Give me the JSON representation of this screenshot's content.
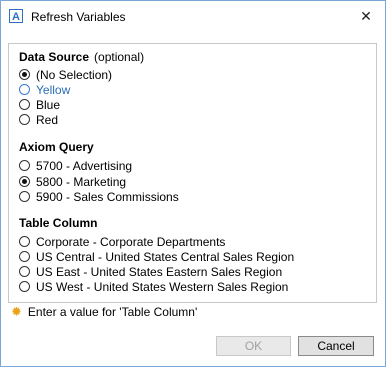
{
  "window": {
    "title": "Refresh Variables",
    "app_icon_letter": "A",
    "close_glyph": "✕"
  },
  "data_source": {
    "heading": "Data Source",
    "optional": "(optional)",
    "options": [
      "(No Selection)",
      "Yellow",
      "Blue",
      "Red"
    ],
    "selected_index": 0
  },
  "axiom_query": {
    "heading": "Axiom Query",
    "options": [
      "5700 - Advertising",
      "5800 - Marketing",
      "5900 - Sales Commissions"
    ],
    "selected_index": 1
  },
  "table_column": {
    "heading": "Table Column",
    "options": [
      "Corporate - Corporate Departments",
      "US Central - United States Central Sales Region",
      "US East - United States Eastern Sales Region",
      "US West - United States Western Sales Region"
    ],
    "selected_index": null
  },
  "status": {
    "message": "Enter a value for 'Table Column'",
    "icon": "sun-icon",
    "icon_color": "#e8a21a"
  },
  "buttons": {
    "ok_label": "OK",
    "ok_enabled": false,
    "cancel_label": "Cancel"
  }
}
